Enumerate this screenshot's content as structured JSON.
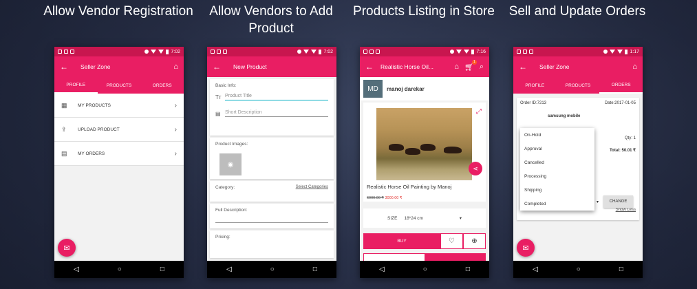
{
  "captions": [
    "Allow Vendor Registration",
    "Allow Vendors to Add Product",
    "Products Listing in Store",
    "Sell and Update Orders"
  ],
  "times": [
    "7:02",
    "7:02",
    "7:16",
    "1:17"
  ],
  "phone1": {
    "title": "Seller Zone",
    "tabs": [
      "PROFILE",
      "PRODUCTS",
      "ORDERS"
    ],
    "menu": [
      "MY PRODUCTS",
      "UPLOAD PRODUCT",
      "MY ORDERS"
    ]
  },
  "phone2": {
    "title": "New Product",
    "basic_info": "Basic Info:",
    "product_title_placeholder": "Product Title",
    "short_desc_placeholder": "Short Description",
    "product_images": "Product Images:",
    "category": "Category:",
    "select_categories": "Select Categories",
    "full_description": "Full Description:",
    "pricing": "Pricing:"
  },
  "phone3": {
    "title": "Realistic Horse Oil...",
    "cart_count": "1",
    "vendor_initials": "MD",
    "vendor_name": "manoj darekar",
    "product_name": "Realistic Horse Oil Painting by Manoj",
    "old_price": "6000.00 ₹",
    "new_price": "3000.00 ₹",
    "size_label": "SIZE",
    "size_value": "18*24 cm",
    "buy_label": "BUY"
  },
  "phone4": {
    "title": "Seller Zone",
    "tabs": [
      "PROFILE",
      "PRODUCTS",
      "ORDERS"
    ],
    "order_id": "Order ID:7213",
    "date": "Date:2017-01-05",
    "product": "samsung mobile",
    "qty": "Qty: 1",
    "total": "Total: 50.01 ₹",
    "status_options": [
      "On-Hold",
      "Approval",
      "Cancelled",
      "Processing",
      "Shipping",
      "Completed"
    ],
    "change_label": "CHANGE",
    "show_less": "Show Less"
  },
  "colors": {
    "accent": "#e91e63",
    "status": "#c8164f"
  }
}
